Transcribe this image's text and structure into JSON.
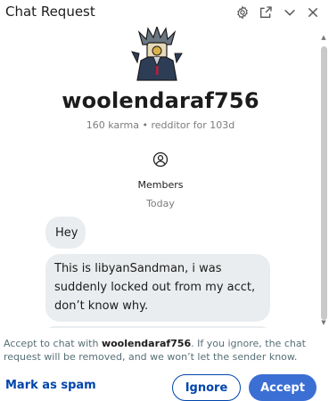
{
  "header": {
    "title": "Chat Request",
    "icons": [
      "gear-icon",
      "open-external-icon",
      "chevron-down-icon",
      "close-icon"
    ]
  },
  "profile": {
    "username": "woolendaraf756",
    "meta": "160 karma • redditor for 103d"
  },
  "members": {
    "label": "Members"
  },
  "date_divider": "Today",
  "messages": [
    {
      "text": "Hey"
    },
    {
      "text": "This is libyanSandman, i was suddenly locked out from my acct, don’t know why."
    }
  ],
  "footer": {
    "notice_prefix": "Accept to chat with ",
    "notice_user": "woolendaraf756",
    "notice_suffix": ". If you ignore, the chat request will be removed, and we won’t let the sender know.",
    "mark_spam_label": "Mark as spam",
    "ignore_label": "Ignore",
    "accept_label": "Accept"
  },
  "colors": {
    "accent": "#3b6fd4",
    "link": "#0045ac",
    "bubble": "#eaedef",
    "muted_text": "#7c7c7c"
  }
}
